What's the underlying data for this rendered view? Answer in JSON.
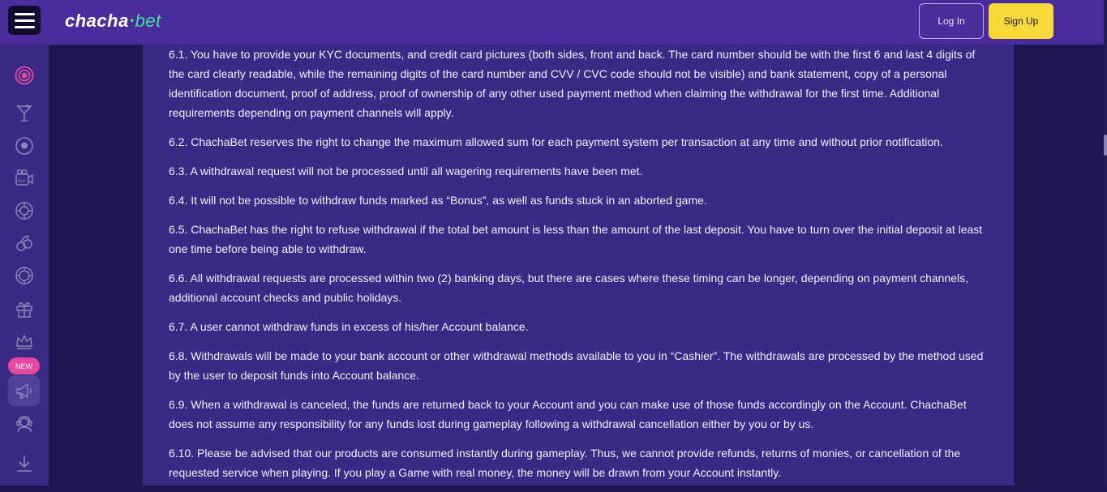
{
  "header": {
    "logo_main": "chacha",
    "logo_dot": "·",
    "logo_bet": "bet",
    "login_label": "Log In",
    "signup_label": "Sign Up"
  },
  "sidebar": {
    "new_badge": "NEW",
    "live_label": "live"
  },
  "colors": {
    "header_bg": "#4a2c9c",
    "sidebar_bg": "#3b2a85",
    "signup_bg": "#f7d83a",
    "badge_bg": "#e64aa0",
    "accent_green": "#3fe0a0"
  },
  "terms": [
    "6.1. You have to provide your KYC documents, and credit card pictures (both sides, front and back. The card number should be with the first 6 and last 4 digits of the card clearly readable, while the remaining digits of the card number and CVV / CVC code should not be visible) and bank statement, copy of a personal identification document, proof of address, proof of ownership of any other used payment method when claiming the withdrawal for the first time. Additional requirements depending on payment channels will apply.",
    "6.2. ChachaBet reserves the right to change the maximum allowed sum for each payment system per transaction at any time and without prior notification.",
    "6.3. A withdrawal request will not be processed until all wagering requirements have been met.",
    "6.4. It will not be possible to withdraw funds marked as “Bonus”, as well as funds stuck in an aborted game.",
    "6.5. ChachaBet has the right to refuse withdrawal if the total bet amount is less than the amount of the last deposit. You have to turn over the initial deposit at least one time before being able to withdraw.",
    "6.6. All withdrawal requests are processed within two (2) banking days, but there are cases where these timing can be longer, depending on payment channels, additional account checks and public holidays.",
    "6.7. A user cannot withdraw funds in excess of his/her Account balance.",
    "6.8. Withdrawals will be made to your bank account or other withdrawal methods available to you in “Cashier”. The withdrawals are processed by the method used by the user to deposit funds into Account balance.",
    "6.9. When a withdrawal is canceled, the funds are returned back to your Account and you can make use of those funds accordingly on the Account. ChachaBet does not assume any responsibility for any funds lost during gameplay following a withdrawal cancellation either by you or by us.",
    "6.10. Please be advised that our products are consumed instantly during gameplay. Thus, we cannot provide refunds, returns of monies, or cancellation of the requested service when playing. If you play a Game with real money, the money will be drawn from your Account instantly."
  ]
}
